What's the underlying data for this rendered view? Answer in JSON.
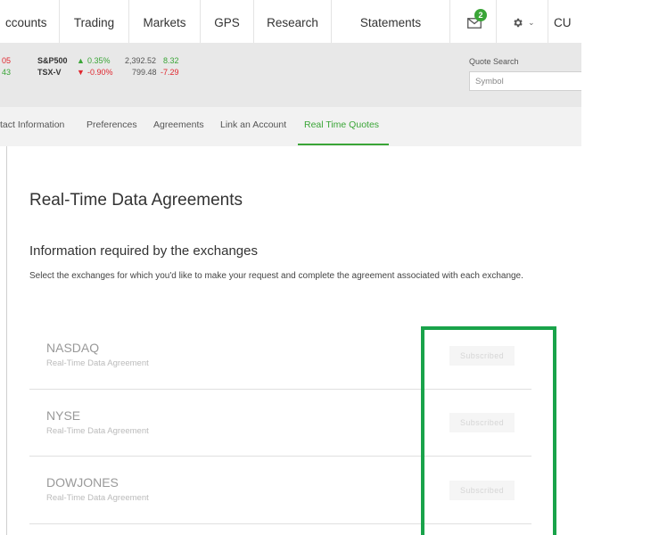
{
  "topnav": {
    "items": [
      {
        "label": "ccounts"
      },
      {
        "label": "Trading"
      },
      {
        "label": "Markets"
      },
      {
        "label": "GPS"
      },
      {
        "label": "Research"
      },
      {
        "label": "Statements"
      }
    ],
    "messages_count": "2",
    "user_label": "CU"
  },
  "ticker": {
    "left_partial": [
      "05",
      "43"
    ],
    "rows": [
      {
        "symbol": "S&P500",
        "change_pct": "0.35%",
        "value": "2,392.52",
        "change": "8.32",
        "direction": "up"
      },
      {
        "symbol": "TSX-V",
        "change_pct": "-0.90%",
        "value": "799.48",
        "change": "-7.29",
        "direction": "down"
      }
    ],
    "quote_search_label": "Quote Search",
    "quote_search_placeholder": "Symbol"
  },
  "subnav": {
    "items": [
      {
        "label": "tact Information"
      },
      {
        "label": "Preferences"
      },
      {
        "label": "Agreements"
      },
      {
        "label": "Link an Account"
      },
      {
        "label": "Real Time Quotes"
      }
    ],
    "active": "Real Time Quotes"
  },
  "main": {
    "title": "Real-Time Data Agreements",
    "section_title": "Information required by the exchanges",
    "description": "Select the exchanges for which you'd like to make your request and complete the agreement associated with each exchange.",
    "exchanges": [
      {
        "name": "NASDAQ",
        "subtitle": "Real-Time Data Agreement",
        "status": "Subscribed"
      },
      {
        "name": "NYSE",
        "subtitle": "Real-Time Data Agreement",
        "status": "Subscribed"
      },
      {
        "name": "DOWJONES",
        "subtitle": "Real-Time Data Agreement",
        "status": "Subscribed"
      }
    ]
  },
  "colors": {
    "accent": "#3aa537",
    "positive": "#3aa537",
    "negative": "#e0262e",
    "highlight_box": "#19a34a"
  },
  "icons": [
    "envelope-icon",
    "gear-icon",
    "chevron-down-icon",
    "caret-up-icon",
    "caret-down-icon"
  ]
}
